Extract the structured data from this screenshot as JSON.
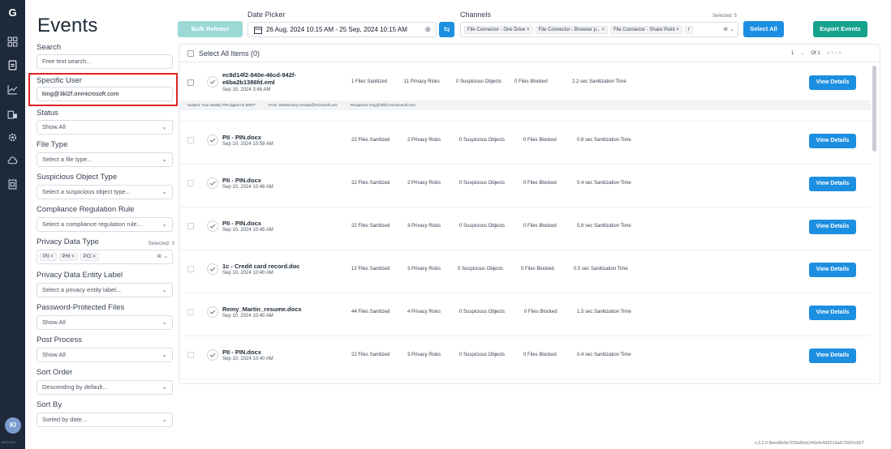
{
  "rail": {
    "logo": "G",
    "icons": [
      "grid-icon",
      "document-icon",
      "chart-icon",
      "building-icon",
      "gear-icon",
      "cloud-icon",
      "report-icon"
    ],
    "avatar": "KI",
    "version": "v3.2.0.8.1"
  },
  "filters": {
    "title": "Events",
    "search": {
      "label": "Search",
      "placeholder": "Free text search..."
    },
    "specific_user": {
      "label": "Specific User",
      "value": "king@3kl2f.onmicrosoft.com"
    },
    "status": {
      "label": "Status",
      "value": "Show All"
    },
    "file_type": {
      "label": "File Type",
      "placeholder": "Select a file type..."
    },
    "suspicious_object_type": {
      "label": "Suspicious Object Type",
      "placeholder": "Select a suspicious object type..."
    },
    "compliance_rule": {
      "label": "Compliance Regulation Rule",
      "placeholder": "Select a compliance regulation rule..."
    },
    "privacy_data_type": {
      "label": "Privacy Data Type",
      "selected": "Selected: 3",
      "chips": [
        "PII ×",
        "PHI ×",
        "PCI ×"
      ],
      "control": "⊗ ⌄"
    },
    "privacy_entity_label": {
      "label": "Privacy Data Entity Label",
      "placeholder": "Select a privacy entity label..."
    },
    "password_protected": {
      "label": "Password-Protected Files",
      "value": "Show All"
    },
    "post_process": {
      "label": "Post Process",
      "value": "Show All"
    },
    "sort_order": {
      "label": "Sort Order",
      "placeholder": "Descending by default..."
    },
    "sort_by": {
      "label": "Sort By",
      "placeholder": "Sorted by date..."
    }
  },
  "toolbar": {
    "bulk_release": "Bulk Release",
    "date_picker_label": "Date Picker",
    "date_range": "26 Aug, 2024 10:15 AM - 25 Sep, 2024 10:15 AM",
    "channels_label": "Channels",
    "channels_selected": "Selected: 5",
    "channels": [
      "File Connector - One Drive ×",
      "File Connector - Browser p... ×",
      "File Connector - Share Point ×",
      "I"
    ],
    "channels_control": "⊗ ⌄",
    "select_all": "Select All",
    "export_events": "Export Events"
  },
  "list": {
    "select_all_label": "Select All Items (0)",
    "pager": {
      "page": "1",
      "of": "Of 1",
      "nav": "« ‹ › »"
    },
    "rows": [
      {
        "name": "ec8d14f2-840e-46cd-942f-e6ba2b1386fd.eml",
        "date": "Sep 15, 2024 3:46 AM",
        "sanitized": "1 Files Sanitized",
        "risks": "11 Privacy Risks",
        "suspicious": "0 Suspicious Objects",
        "blocked": "0 Files Blocked",
        "time": "2.2 sec Sanitization Time",
        "button": "View Details"
      },
      {
        "name": "PII - PIN.docx",
        "date": "Sep 10, 2024 10:59 AM",
        "sanitized": "22 Files Sanitized",
        "risks": "2 Privacy Risks",
        "suspicious": "0 Suspicious Objects",
        "blocked": "0 Files Blocked",
        "time": "0.8 sec Sanitization Time",
        "button": "View Details"
      },
      {
        "name": "PII - PIN.docx",
        "date": "Sep 10, 2024 10:46 AM",
        "sanitized": "22 Files Sanitized",
        "risks": "2 Privacy Risks",
        "suspicious": "0 Suspicious Objects",
        "blocked": "0 Files Blocked",
        "time": "0.4 sec Sanitization Time",
        "button": "View Details"
      },
      {
        "name": "PII - PIN.docx",
        "date": "Sep 10, 2024 10:45 AM",
        "sanitized": "22 Files Sanitized",
        "risks": "3 Privacy Risks",
        "suspicious": "0 Suspicious Objects",
        "blocked": "0 Files Blocked",
        "time": "0.8 sec Sanitization Time",
        "button": "View Details"
      },
      {
        "name": "1c - Credit card record.doc",
        "date": "Sep 10, 2024 10:40 AM",
        "sanitized": "12 Files Sanitized",
        "risks": "3 Privacy Risks",
        "suspicious": "0 Suspicious Objects",
        "blocked": "0 Files Blocked",
        "time": "0.5 sec Sanitization Time",
        "button": "View Details"
      },
      {
        "name": "Remy_Martin_resume.docx",
        "date": "Sep 10, 2024 10:40 AM",
        "sanitized": "44 Files Sanitized",
        "risks": "4 Privacy Risks",
        "suspicious": "0 Suspicious Objects",
        "blocked": "0 Files Blocked",
        "time": "1.5 sec Sanitization Time",
        "button": "View Details"
      },
      {
        "name": "PII - PIN.docx",
        "date": "Sep 10, 2024 10:40 AM",
        "sanitized": "22 Files Sanitized",
        "risks": "3 Privacy Risks",
        "suspicious": "0 Suspicious Objects",
        "blocked": "0 Files Blocked",
        "time": "0.4 sec Sanitization Time",
        "button": "View Details"
      }
    ],
    "detail": {
      "subject": "Subject: Your weekly PIM digest for MSFT",
      "from": "From: MSSecurity-noreply@microsoft.com",
      "recipients": "Recipients: king@3kl2f.onmicrosoft.com"
    }
  },
  "footer_version": "v.3.2.0.8eed8e0e7f33af3cb245efe443213a672d01cb57"
}
